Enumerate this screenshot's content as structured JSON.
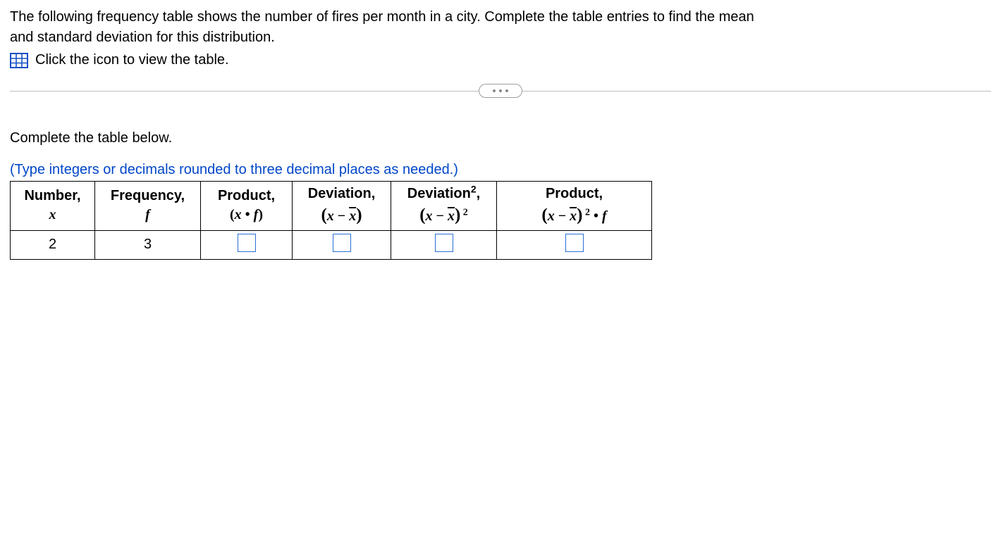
{
  "intro_line1": "The following frequency table shows the number of fires per month in a city. Complete the table entries to find the mean",
  "intro_line2": "and standard deviation for this distribution.",
  "icon_link_text": "Click the icon to view the table.",
  "divider_aria": "show-more",
  "complete_label": "Complete the table below.",
  "hint_text": "(Type integers or decimals rounded to three decimal places as needed.)",
  "headers": {
    "x_top": "Number,",
    "x_sub": "x",
    "f_top": "Frequency,",
    "f_sub": "f",
    "xf_top": "Product,",
    "xf_sub_html": "(x • f)",
    "dev_top": "Deviation,",
    "dev2_top_html": "Deviation",
    "prod2_top": "Product,"
  },
  "row": {
    "x": "2",
    "f": "3"
  }
}
